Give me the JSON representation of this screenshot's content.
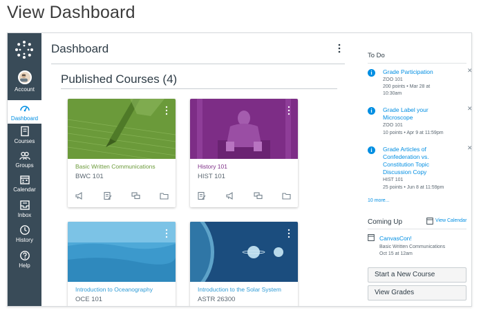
{
  "page_heading": "View Dashboard",
  "nav": {
    "items": [
      {
        "label": "Account",
        "icon": "avatar"
      },
      {
        "label": "Dashboard",
        "icon": "dashboard-icon"
      },
      {
        "label": "Courses",
        "icon": "courses-icon"
      },
      {
        "label": "Groups",
        "icon": "groups-icon"
      },
      {
        "label": "Calendar",
        "icon": "calendar-icon"
      },
      {
        "label": "Inbox",
        "icon": "inbox-icon"
      },
      {
        "label": "History",
        "icon": "history-icon"
      },
      {
        "label": "Help",
        "icon": "help-icon"
      }
    ],
    "active": "Dashboard"
  },
  "main": {
    "title": "Dashboard",
    "section_title": "Published Courses (4)"
  },
  "courses": [
    {
      "name": "Basic Written Communications",
      "code": "BWC 101",
      "color": "#6b9a3a",
      "icons": [
        "announcements-icon",
        "assignments-icon",
        "discussions-icon",
        "files-icon"
      ]
    },
    {
      "name": "History 101",
      "code": "HIST 101",
      "color": "#7d2d86",
      "icons": [
        "assignments-icon",
        "announcements-icon",
        "discussions-icon",
        "files-icon"
      ]
    },
    {
      "name": "Introduction to Oceanography",
      "code": "OCE 101",
      "color": "#2d9bd6",
      "icons": []
    },
    {
      "name": "Introduction to the Solar System",
      "code": "ASTR 26300",
      "color": "#2d9bd6",
      "icons": []
    }
  ],
  "todo": {
    "heading": "To Do",
    "items": [
      {
        "title": "Grade Participation",
        "course": "ZOO 101",
        "meta": "200 points • Mar 28 at 10:30am"
      },
      {
        "title": "Grade Label your Microscope",
        "course": "ZOO 101",
        "meta": "10 points • Apr 9 at 11:59pm"
      },
      {
        "title": "Grade Articles of Confederation vs. Constitution Topic Discussion Copy",
        "course": "HIST 101",
        "meta": "25 points • Jun 8 at 11:59pm"
      }
    ],
    "more": "10 more..."
  },
  "coming_up": {
    "heading": "Coming Up",
    "view_calendar": "View Calendar",
    "event_title": "CanvasCon!",
    "event_course": "Basic Written Communications",
    "event_date": "Oct 15 at 12am"
  },
  "buttons": {
    "new_course": "Start a New Course",
    "view_grades": "View Grades"
  },
  "colors": {
    "nav_bg": "#394b58",
    "link": "#008ee2"
  }
}
